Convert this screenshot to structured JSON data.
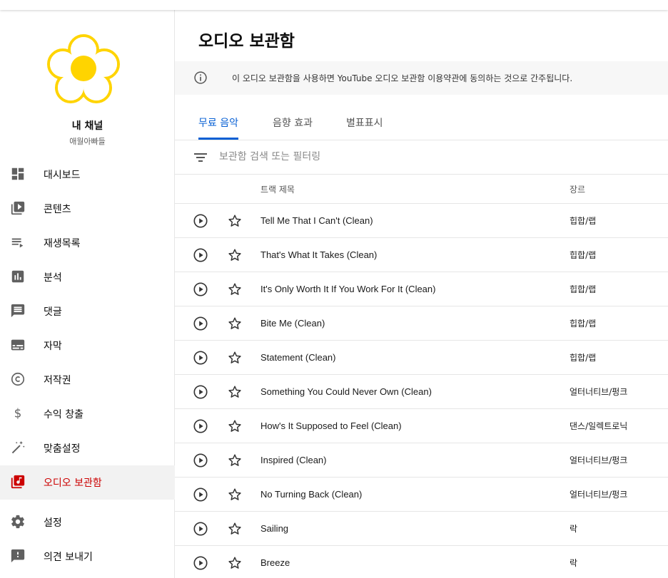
{
  "channel": {
    "title": "내 채널",
    "name": "애월아빠들"
  },
  "nav": {
    "items": [
      {
        "label": "대시보드",
        "icon": "dashboard-icon"
      },
      {
        "label": "콘텐츠",
        "icon": "video-library-icon"
      },
      {
        "label": "재생목록",
        "icon": "playlist-icon"
      },
      {
        "label": "분석",
        "icon": "analytics-icon"
      },
      {
        "label": "댓글",
        "icon": "comment-icon"
      },
      {
        "label": "자막",
        "icon": "subtitles-icon"
      },
      {
        "label": "저작권",
        "icon": "copyright-icon"
      },
      {
        "label": "수익 창출",
        "icon": "dollar-icon"
      },
      {
        "label": "맞춤설정",
        "icon": "magic-wand-icon"
      },
      {
        "label": "오디오 보관함",
        "icon": "audio-library-icon",
        "active": true
      }
    ],
    "bottom": [
      {
        "label": "설정",
        "icon": "gear-icon"
      },
      {
        "label": "의견 보내기",
        "icon": "feedback-icon"
      }
    ]
  },
  "page": {
    "title": "오디오 보관함",
    "notice": "이 오디오 보관함을 사용하면 YouTube 오디오 보관함 이용약관에 동의하는 것으로 간주됩니다."
  },
  "tabs": [
    {
      "label": "무료 음악",
      "active": true
    },
    {
      "label": "음향 효과",
      "active": false
    },
    {
      "label": "별표표시",
      "active": false
    }
  ],
  "filter": {
    "placeholder": "보관함 검색 또는 필터링"
  },
  "table": {
    "columns": {
      "title": "트랙 제목",
      "genre": "장르"
    },
    "rows": [
      {
        "title": "Tell Me That I Can't (Clean)",
        "genre": "힙합/랩"
      },
      {
        "title": "That's What It Takes (Clean)",
        "genre": "힙합/랩"
      },
      {
        "title": "It's Only Worth It If You Work For It (Clean)",
        "genre": "힙합/랩"
      },
      {
        "title": "Bite Me (Clean)",
        "genre": "힙합/랩"
      },
      {
        "title": "Statement (Clean)",
        "genre": "힙합/랩"
      },
      {
        "title": "Something You Could Never Own (Clean)",
        "genre": "얼터너티브/펑크"
      },
      {
        "title": "How's It Supposed to Feel (Clean)",
        "genre": "댄스/일렉트로닉"
      },
      {
        "title": "Inspired (Clean)",
        "genre": "얼터너티브/펑크"
      },
      {
        "title": "No Turning Back (Clean)",
        "genre": "얼터너티브/펑크"
      },
      {
        "title": "Sailing",
        "genre": "락"
      },
      {
        "title": "Breeze",
        "genre": "락"
      }
    ]
  },
  "colors": {
    "accent_blue": "#065fd4",
    "active_red": "#cc0000",
    "flower_yellow": "#ffd400"
  }
}
